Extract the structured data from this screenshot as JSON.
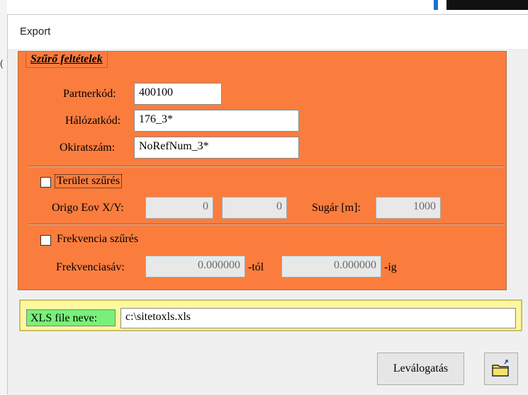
{
  "window": {
    "title": "Export"
  },
  "filter": {
    "legend": "Szűrő feltételek",
    "partnerkod": {
      "label": "Partnerkód:",
      "value": "400100"
    },
    "halozatkod": {
      "label": "Hálózatkód:",
      "value": "176_3*"
    },
    "okiratszam": {
      "label": "Okiratszám:",
      "value": "NoRefNum_3*"
    },
    "terulet": {
      "checkbox_label": "Terület szűrés",
      "checked": false,
      "origo_label": "Origo Eov X/Y:",
      "x_value": "0",
      "y_value": "0",
      "sugar_label": "Sugár [m]:",
      "sugar_value": "1000"
    },
    "frekvencia": {
      "checkbox_label": "Frekvencia szűrés",
      "checked": false,
      "sav_label": "Frekvenciasáv:",
      "from_value": "0.000000",
      "from_suffix": "-tól",
      "to_value": "0.000000",
      "to_suffix": "-ig"
    }
  },
  "xls": {
    "label": "XLS file neve:",
    "value": "c:\\sitetoxls.xls"
  },
  "actions": {
    "submit_label": "Leválogatás",
    "folder_icon": "open-folder-icon"
  },
  "colors": {
    "filter_bg": "#fb7d3e",
    "xls_bg": "#fdf7a0",
    "xls_label_bg": "#79f079"
  }
}
